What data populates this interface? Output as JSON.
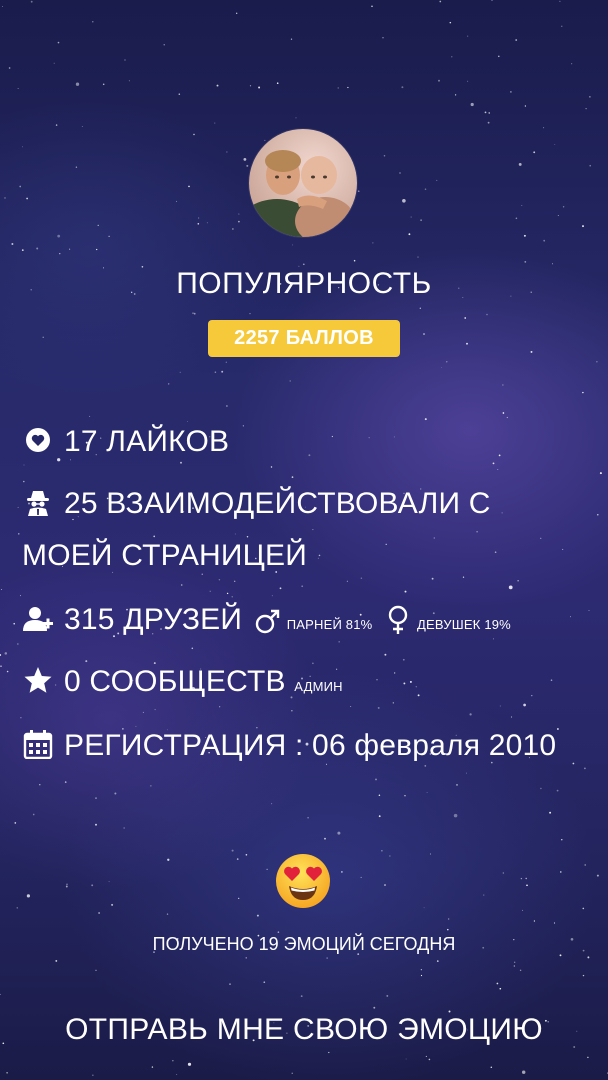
{
  "profile": {
    "avatar_alt": "avatar",
    "title": "ПОПУЛЯРНОСТЬ",
    "score": "2257 БАЛЛОВ"
  },
  "stats": {
    "likes": "17 ЛАЙКОВ",
    "interactions": "25 ВЗАИМОДЕЙСТВОВАЛИ С МОЕЙ СТРАНИЦЕЙ",
    "friends": "315 ДРУЗЕЙ",
    "men": "ПАРНЕЙ 81%",
    "women": "ДЕВУШЕК 19%",
    "communities": "0 СООБЩЕСТВ",
    "communities_note": "АДМИН",
    "registration": "РЕГИСТРАЦИЯ : 06 февраля 2010"
  },
  "emotions": {
    "emoji": "heart-eyes-emoji",
    "received": "ПОЛУЧЕНО 19 ЭМОЦИЙ СЕГОДНЯ",
    "send": "ОТПРАВЬ МНЕ СВОЮ ЭМОЦИЮ"
  },
  "icons": {
    "likes": "heart-icon",
    "interactions": "spy-icon",
    "friends": "add-user-icon",
    "men": "male-icon",
    "women": "female-icon",
    "communities": "star-icon",
    "registration": "calendar-icon"
  },
  "colors": {
    "badge": "#f6c93b",
    "text": "#ffffff"
  }
}
